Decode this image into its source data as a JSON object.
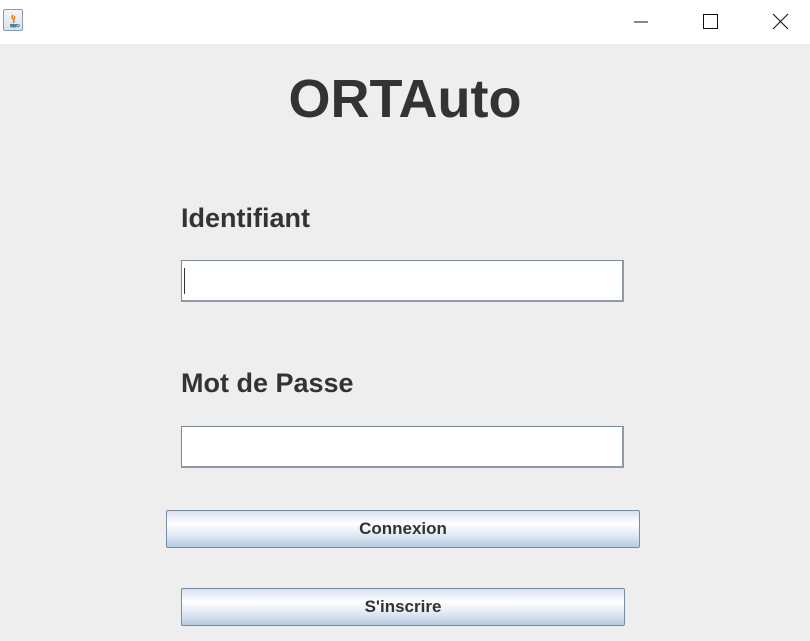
{
  "window": {
    "app_icon": "java-cup-icon",
    "controls": [
      "minimize-icon",
      "maximize-icon",
      "close-icon"
    ]
  },
  "app": {
    "title": "ORTAuto"
  },
  "form": {
    "username_label": "Identifiant",
    "username_value": "",
    "password_label": "Mot de Passe",
    "password_value": ""
  },
  "buttons": {
    "login_label": "Connexion",
    "register_label": "S'inscrire"
  },
  "colors": {
    "background": "#eeeeee",
    "text": "#333333",
    "button_border": "#7a8aa0"
  }
}
